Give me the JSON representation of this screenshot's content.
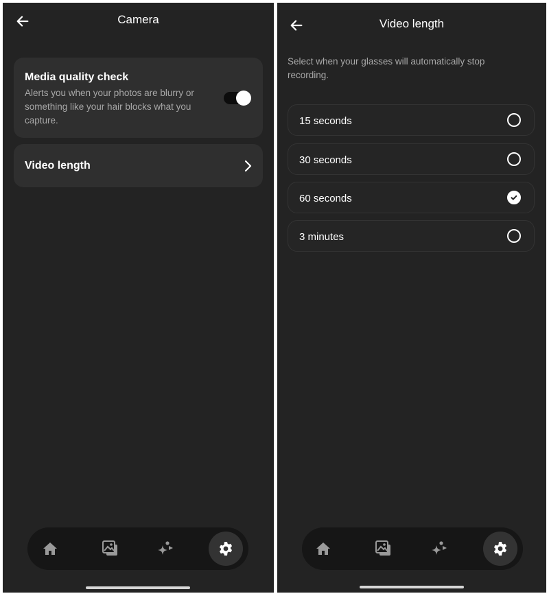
{
  "camera_screen": {
    "title": "Camera",
    "back_icon": "arrow-left-icon",
    "media_quality": {
      "title": "Media quality check",
      "description": "Alerts you when your photos are blurry or something like your hair blocks what you capture.",
      "enabled": true
    },
    "video_length": {
      "label": "Video length",
      "icon": "chevron-right-icon"
    }
  },
  "video_length_screen": {
    "title": "Video length",
    "back_icon": "arrow-left-icon",
    "description": "Select when your glasses will automatically stop recording.",
    "options": [
      {
        "label": "15 seconds",
        "selected": false
      },
      {
        "label": "30 seconds",
        "selected": false
      },
      {
        "label": "60 seconds",
        "selected": true
      },
      {
        "label": "3 minutes",
        "selected": false
      }
    ]
  },
  "bottom_nav": {
    "items": [
      {
        "name": "home",
        "icon": "home-icon",
        "active": false
      },
      {
        "name": "gallery",
        "icon": "gallery-icon",
        "active": false
      },
      {
        "name": "ai",
        "icon": "sparkle-icon",
        "active": false
      },
      {
        "name": "settings",
        "icon": "gear-icon",
        "active": true
      }
    ]
  },
  "colors": {
    "background": "#232323",
    "card": "#2f2f2f",
    "text_primary": "#ffffff",
    "text_secondary": "#a8a8a8",
    "nav_bar": "#161616"
  }
}
